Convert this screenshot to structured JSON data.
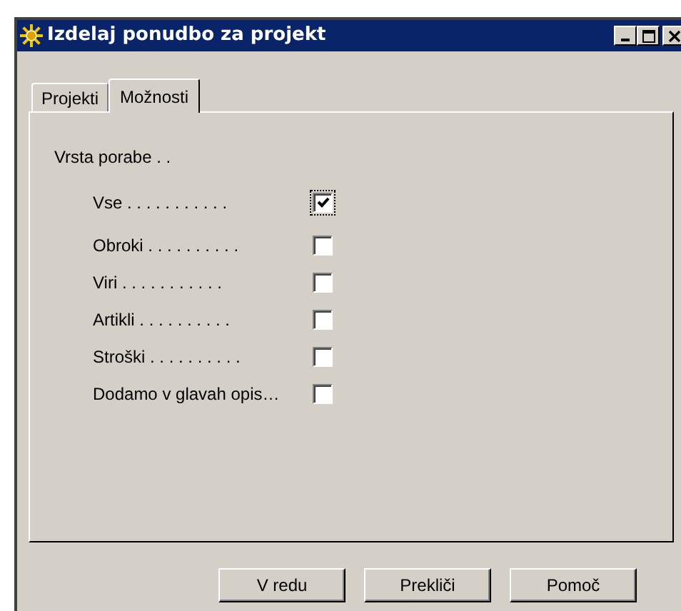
{
  "window": {
    "title": "Izdelaj ponudbo za projekt"
  },
  "tabs": [
    {
      "label": "Projekti",
      "selected": false
    },
    {
      "label": "Možnosti",
      "selected": true
    }
  ],
  "group": {
    "label": "Vrsta porabe . ."
  },
  "options": [
    {
      "label": "Vse . . . . . . . . . . .",
      "checked": true,
      "focused": true
    },
    {
      "label": "Obroki . . . . . . . . . .",
      "checked": false,
      "focused": false
    },
    {
      "label": "Viri . . . . . . . . . . .",
      "checked": false,
      "focused": false
    },
    {
      "label": "Artikli . . . . . . . . . .",
      "checked": false,
      "focused": false
    },
    {
      "label": "Stroški . . . . . . . . . .",
      "checked": false,
      "focused": false
    },
    {
      "label": "Dodamo v glavah opis…",
      "checked": false,
      "focused": false
    }
  ],
  "buttons": [
    "V redu",
    "Prekliči",
    "Pomoč"
  ]
}
